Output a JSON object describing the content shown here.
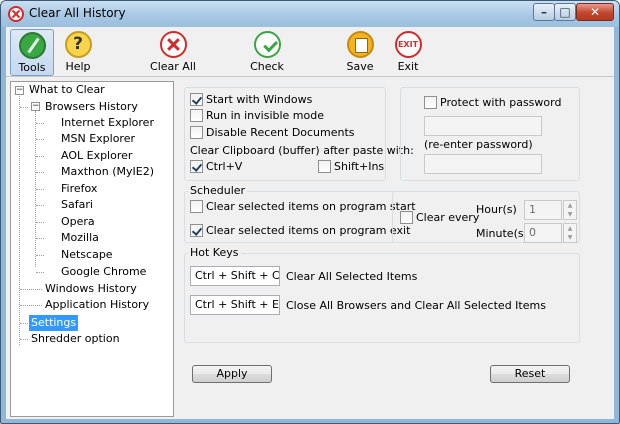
{
  "window": {
    "title": "Clear All History"
  },
  "toolbar": {
    "tools": "Tools",
    "help": "Help",
    "help_glyph": "?",
    "clear_all": "Clear All",
    "check": "Check",
    "save": "Save",
    "exit": "Exit",
    "exit_glyph": "EXIT"
  },
  "tree": {
    "root": "What to Clear",
    "browsers": "Browsers History",
    "browser_items": [
      "Internet Explorer",
      "MSN Explorer",
      "AOL Explorer",
      "Maxthon (MyIE2)",
      "Firefox",
      "Safari",
      "Opera",
      "Mozilla",
      "Netscape",
      "Google Chrome"
    ],
    "windows": "Windows History",
    "application": "Application History",
    "settings": "Settings",
    "shredder": "Shredder option",
    "expander_glyph": "−"
  },
  "options": {
    "start_with_windows": "Start with Windows",
    "run_invisible": "Run in invisible mode",
    "disable_recent": "Disable Recent Documents",
    "clipboard_label": "Clear Clipboard (buffer) after paste with:",
    "ctrl_v": "Ctrl+V",
    "shift_ins": "Shift+Ins"
  },
  "password": {
    "protect": "Protect with password",
    "reenter": "(re-enter password)"
  },
  "scheduler": {
    "title": "Scheduler",
    "on_start": "Clear selected items on program start",
    "on_exit": "Clear selected items on program exit",
    "clear_every": "Clear every",
    "hours_label": "Hour(s)",
    "hours_value": "1",
    "minutes_label": "Minute(s)",
    "minutes_value": "0"
  },
  "hotkeys": {
    "title": "Hot Keys",
    "key1": "Ctrl + Shift + C",
    "desc1": "Clear All Selected Items",
    "key2": "Ctrl + Shift + E",
    "desc2": "Close All Browsers and Clear All Selected Items"
  },
  "buttons": {
    "apply": "Apply",
    "reset": "Reset"
  },
  "state": {
    "start_with_windows": true,
    "run_invisible": false,
    "disable_recent": false,
    "ctrl_v": true,
    "shift_ins": false,
    "protect": false,
    "on_start": false,
    "on_exit": true,
    "clear_every": false
  }
}
